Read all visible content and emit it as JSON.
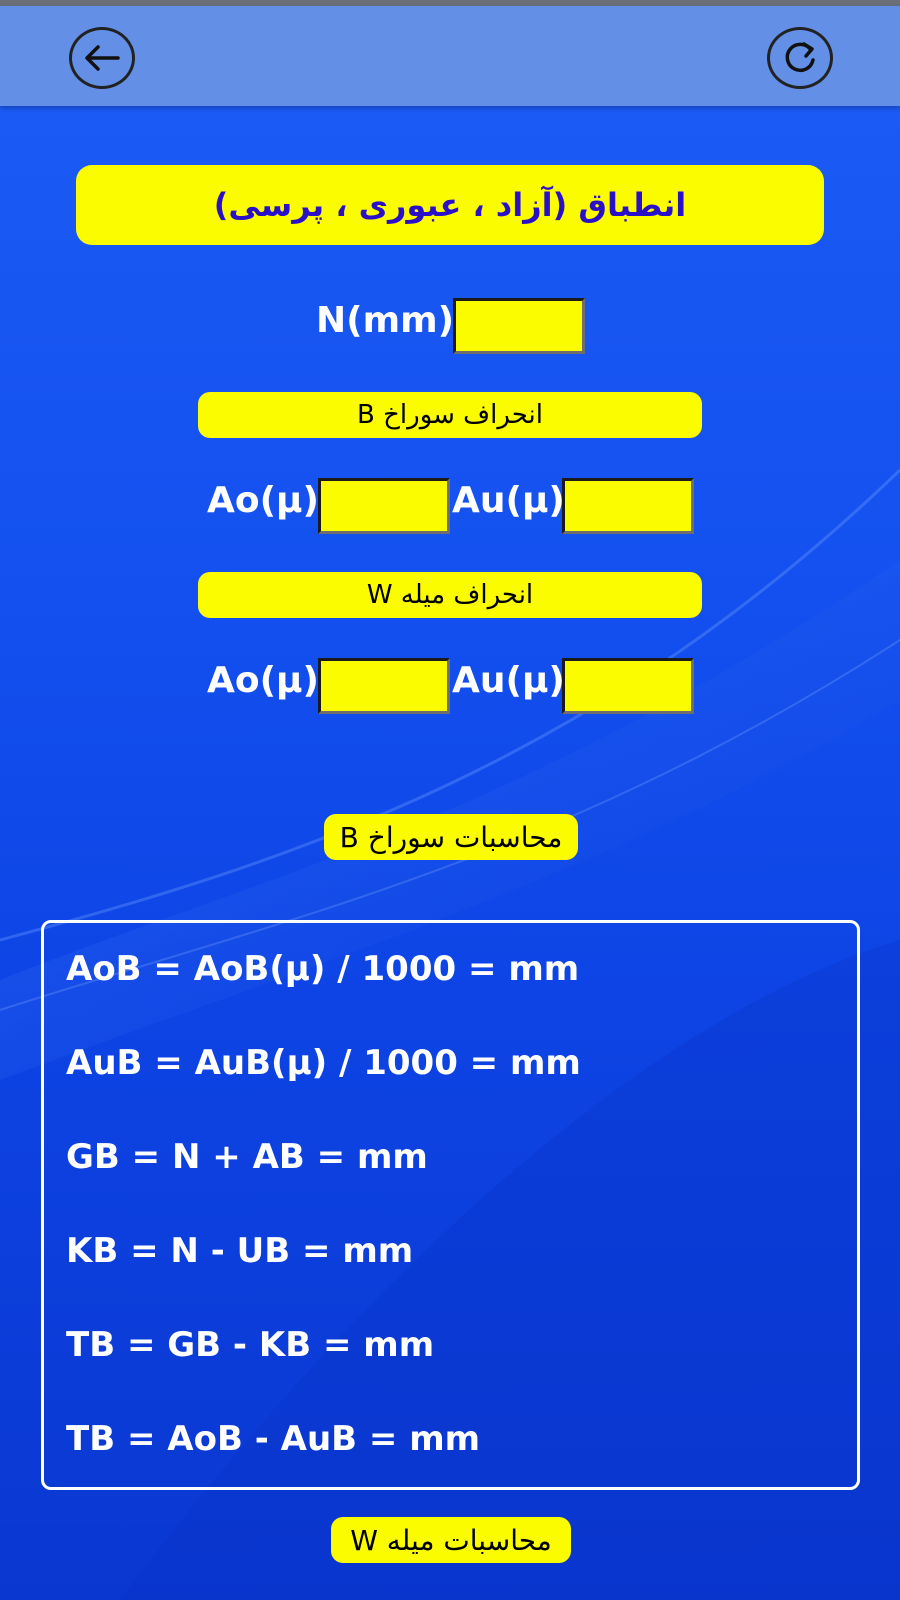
{
  "app": {
    "back_icon": "arrow-left-icon",
    "refresh_icon": "refresh-icon"
  },
  "title": "انطباق (آزاد ، عبوری ، پرسی)",
  "nominal": {
    "label": "N(mm)",
    "value": ""
  },
  "hole_section": {
    "title": "انحراف سوراخ B",
    "ao_label": "Ao(µ)",
    "au_label": "Au(µ)",
    "ao_value": "",
    "au_value": ""
  },
  "shaft_section": {
    "title": "انحراف میله W",
    "ao_label": "Ao(µ)",
    "au_label": "Au(µ)",
    "ao_value": "",
    "au_value": ""
  },
  "calc_hole_button": "محاسبات سوراخ B",
  "results": [
    "AoB = AoB(µ) / 1000 = mm",
    "AuB = AuB(µ) / 1000 = mm",
    "GB = N + AB = mm",
    "KB = N - UB = mm",
    "TB = GB - KB = mm",
    "TB = AoB - AuB = mm"
  ],
  "calc_shaft_button": "محاسبات میله W",
  "colors": {
    "accent_yellow": "#fcfc00",
    "appbar": "#6390e6",
    "background_blue": "#1451f0",
    "title_text": "#2a10c8"
  }
}
